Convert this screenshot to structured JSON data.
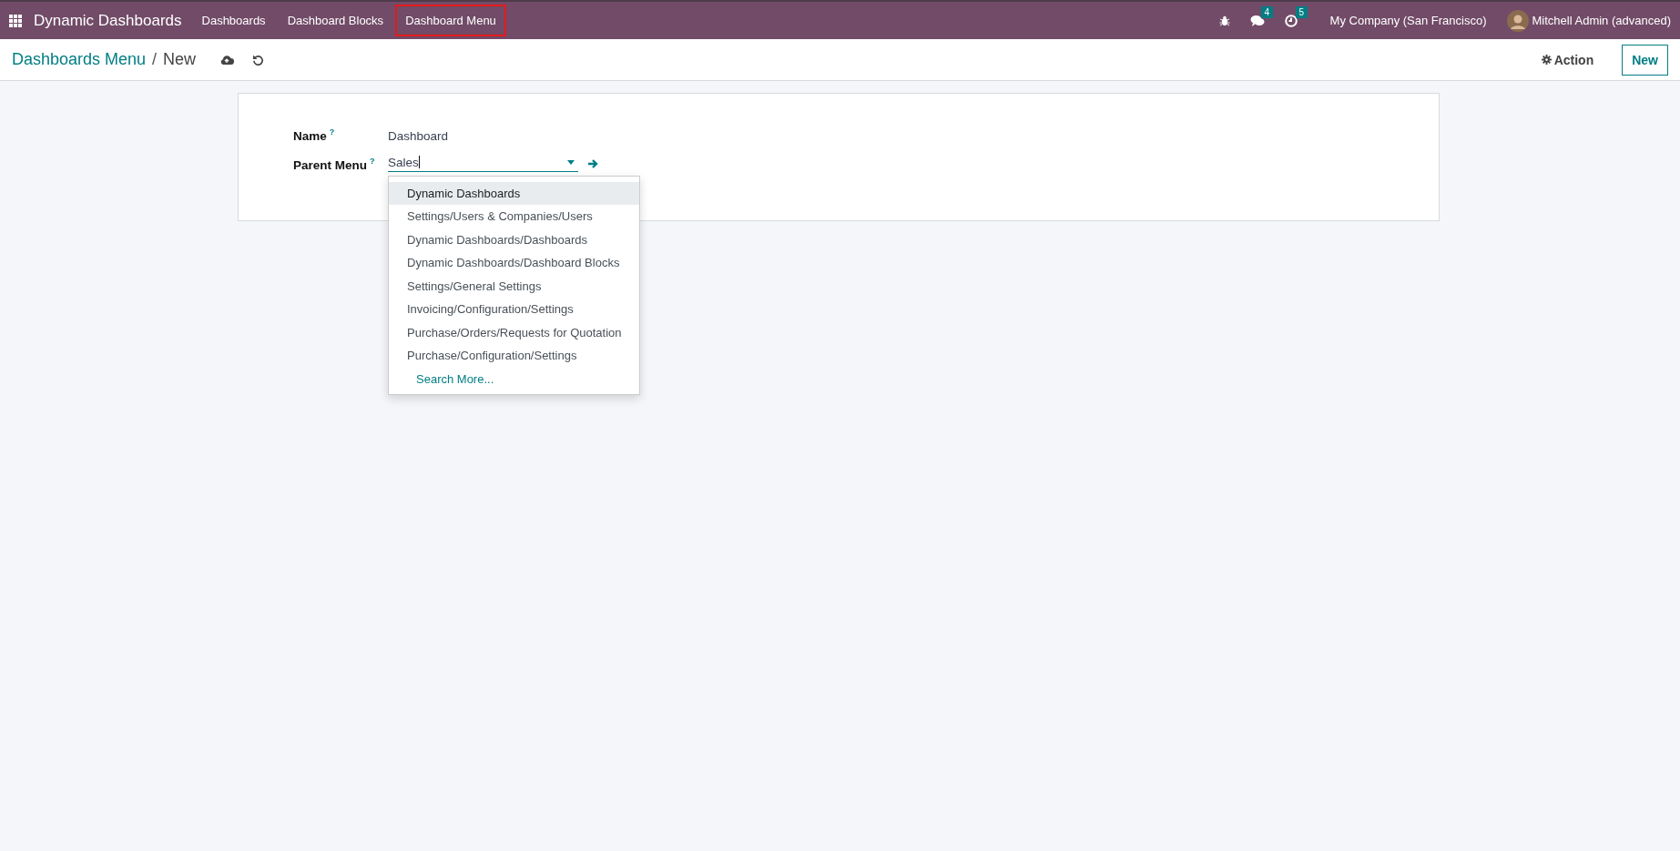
{
  "navbar": {
    "app_name": "Dynamic Dashboards",
    "menu": [
      {
        "label": "Dashboards",
        "highlighted": false
      },
      {
        "label": "Dashboard Blocks",
        "highlighted": false
      },
      {
        "label": "Dashboard Menu",
        "highlighted": true
      }
    ],
    "messages_count": "4",
    "activities_count": "5",
    "company": "My Company (San Francisco)",
    "user": "Mitchell Admin (advanced)"
  },
  "breadcrumb": {
    "parent": "Dashboards Menu",
    "separator": "/",
    "current": "New"
  },
  "actions": {
    "action": "Action",
    "new": "New"
  },
  "form": {
    "name_label": "Name",
    "name_help": "?",
    "name_value": "Dashboard",
    "parent_label": "Parent Menu",
    "parent_help": "?",
    "parent_value": "Sales"
  },
  "dropdown": {
    "items": [
      {
        "label": "Dynamic Dashboards",
        "selected": true
      },
      {
        "label": "Settings/Users & Companies/Users",
        "selected": false
      },
      {
        "label": "Dynamic Dashboards/Dashboards",
        "selected": false
      },
      {
        "label": "Dynamic Dashboards/Dashboard Blocks",
        "selected": false
      },
      {
        "label": "Settings/General Settings",
        "selected": false
      },
      {
        "label": "Invoicing/Configuration/Settings",
        "selected": false
      },
      {
        "label": "Purchase/Orders/Requests for Quotation",
        "selected": false
      },
      {
        "label": "Purchase/Configuration/Settings",
        "selected": false
      }
    ],
    "search_more": "Search More..."
  }
}
